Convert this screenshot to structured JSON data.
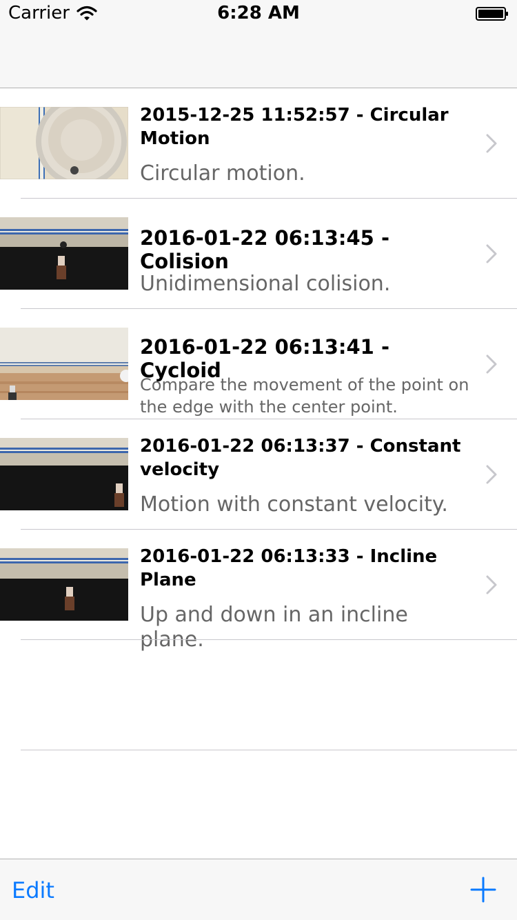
{
  "status_bar": {
    "carrier": "Carrier",
    "time": "6:28 AM"
  },
  "colors": {
    "accent": "#0a7aff",
    "subtitle": "#666666",
    "separator": "#c8c7cc",
    "bar_background": "#f7f7f7"
  },
  "rows": [
    {
      "title": "2015-12-25 11:52:57 - Circular Motion",
      "description": "Circular motion.",
      "thumbnail": "circular-plate-thumbnail"
    },
    {
      "title": "2016-01-22 06:13:45 - Colision",
      "description": "Unidimensional colision.",
      "thumbnail": "colision-track-thumbnail"
    },
    {
      "title": "2016-01-22 06:13:41 - Cycloid",
      "description": "Compare the movement of the point on the edge with the center point.",
      "thumbnail": "cycloid-floor-thumbnail"
    },
    {
      "title": "2016-01-22 06:13:37 - Constant velocity",
      "description": "Motion with constant velocity.",
      "thumbnail": "constant-velocity-thumbnail"
    },
    {
      "title": "2016-01-22 06:13:33 - Incline Plane",
      "description": "Up and down in an incline plane.",
      "thumbnail": "incline-plane-thumbnail"
    }
  ],
  "toolbar": {
    "edit_label": "Edit",
    "add_icon": "plus-icon"
  }
}
